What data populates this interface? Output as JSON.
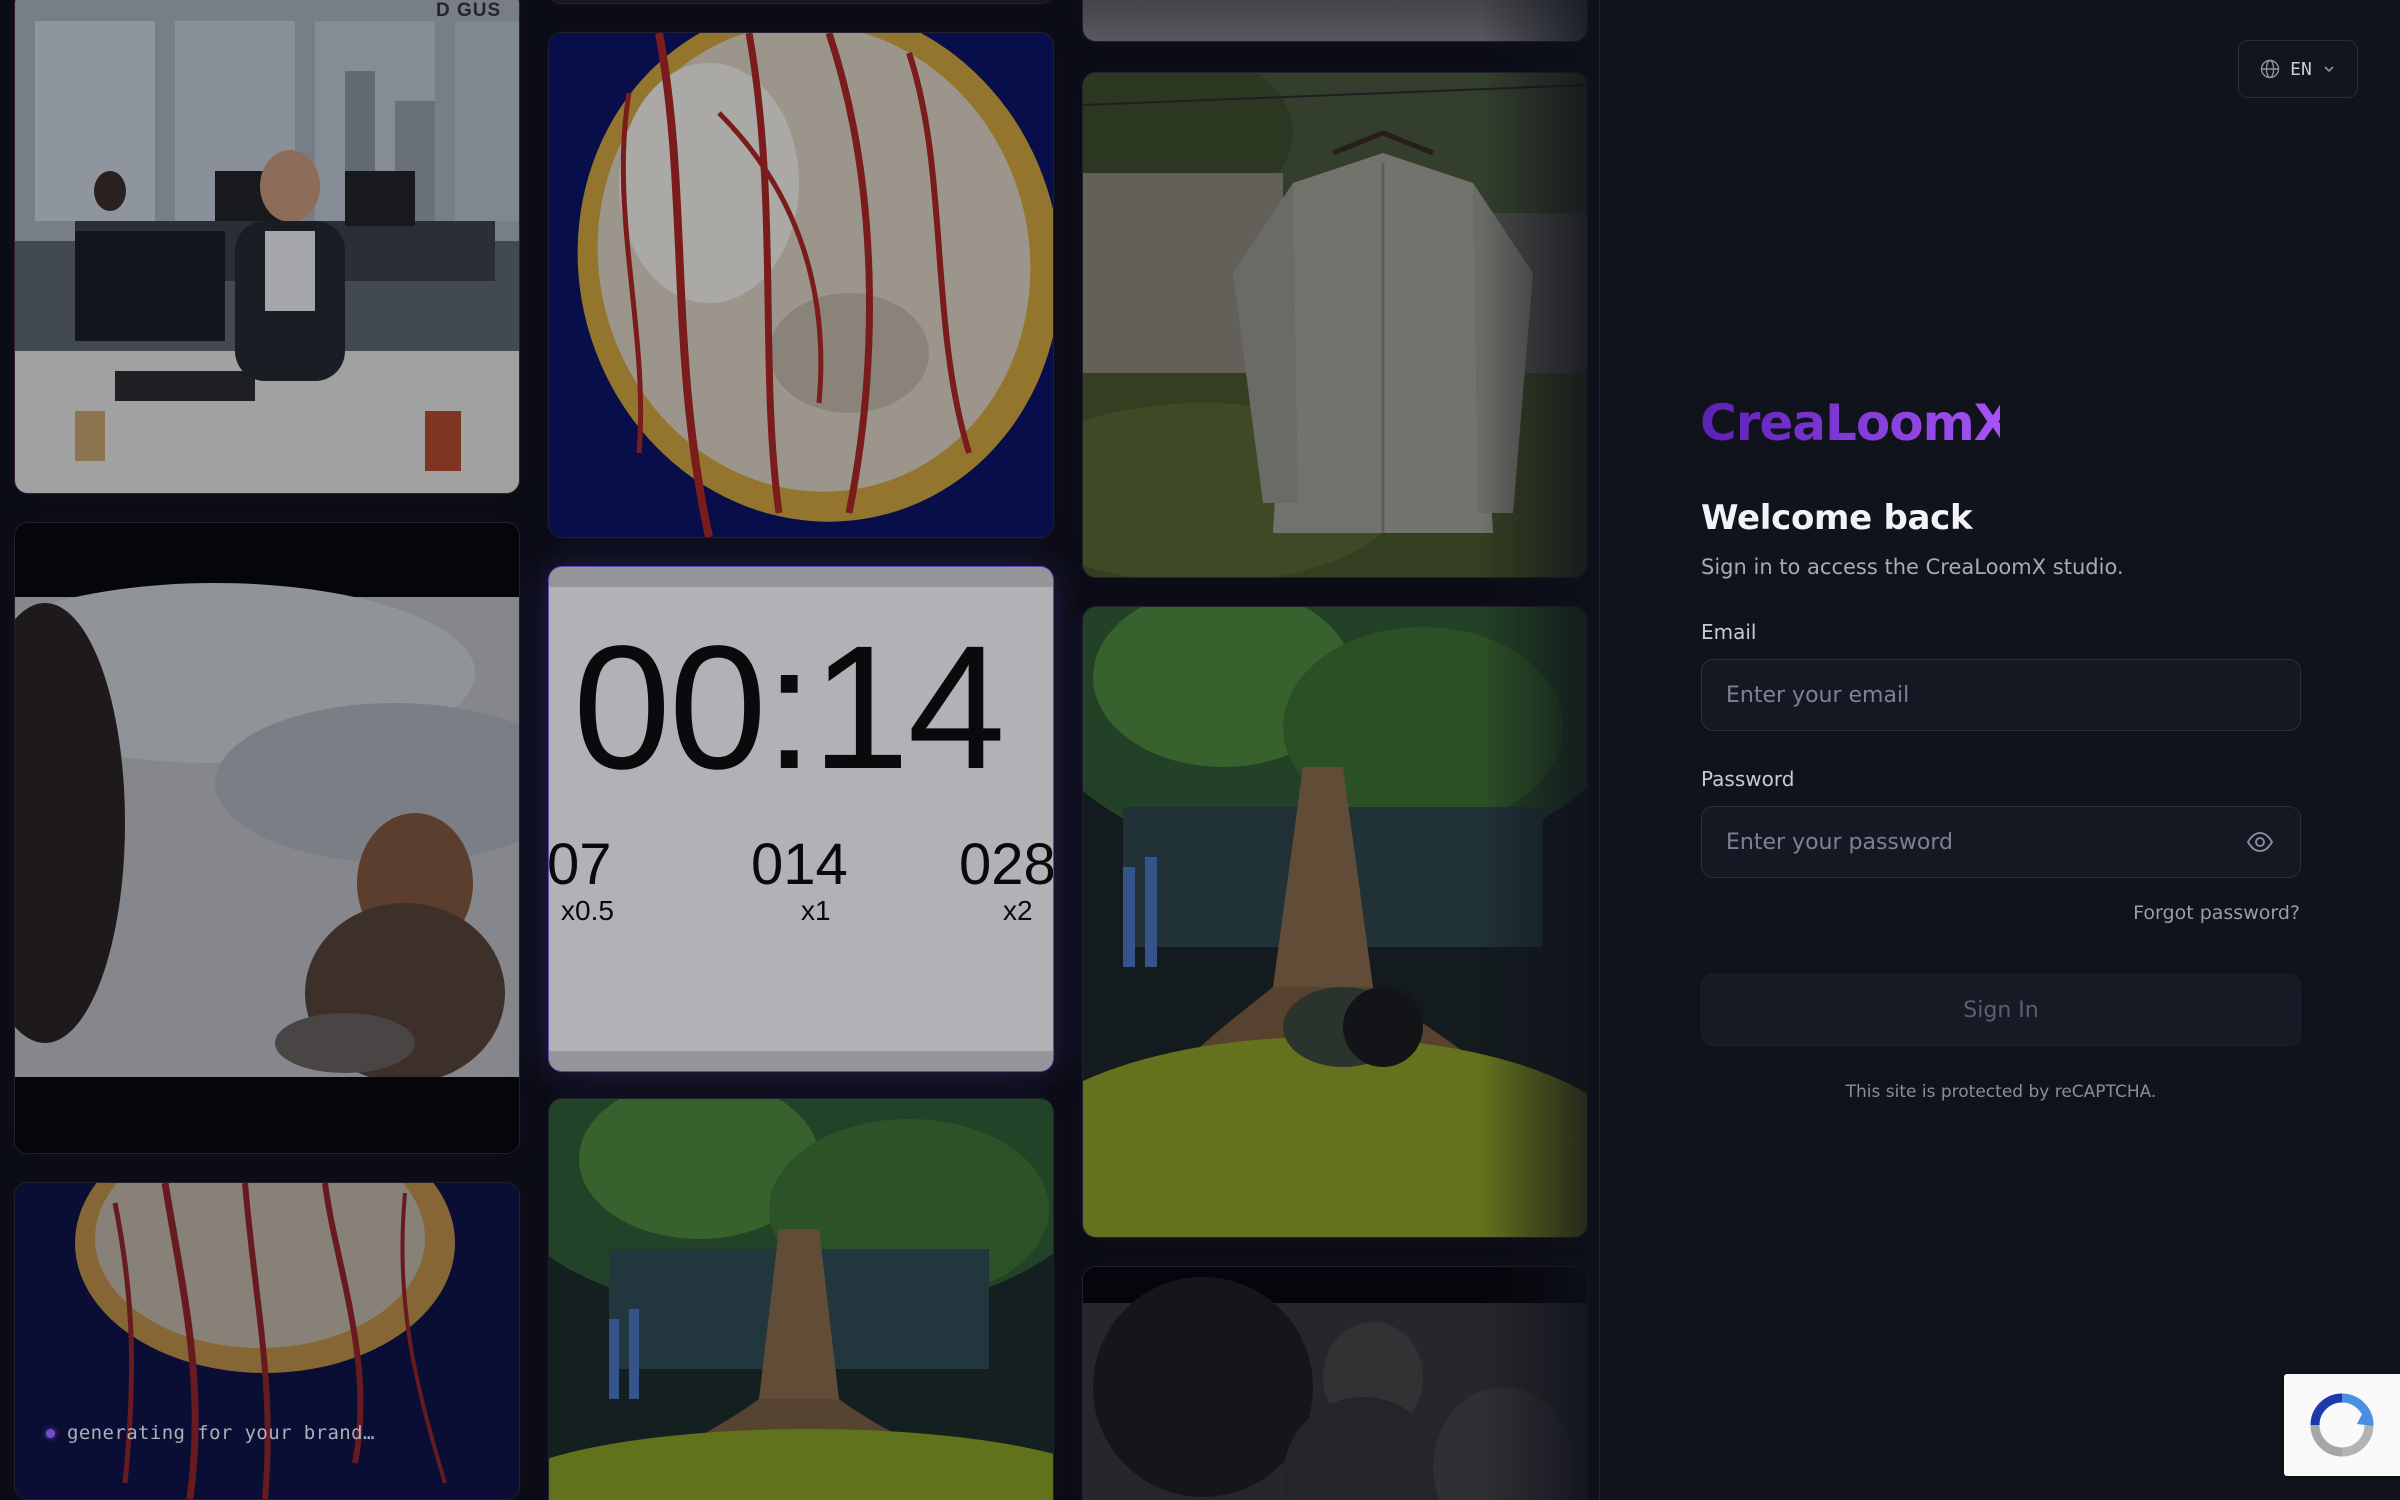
{
  "gallery": {
    "watermark": "D GUS",
    "timer": {
      "main": "00:14",
      "ticks": [
        "07",
        "014",
        "028"
      ],
      "speeds": [
        "x0.5",
        "x1",
        "x2"
      ]
    },
    "status_text": "generating for your brand…"
  },
  "header": {
    "language": "EN"
  },
  "brand": {
    "name": "CreaLoomX",
    "gradient_from": "#5b21b6",
    "gradient_to": "#a855f7"
  },
  "login": {
    "title": "Welcome back",
    "subtitle": "Sign in to access the CreaLoomX studio.",
    "email_label": "Email",
    "email_placeholder": "Enter your email",
    "password_label": "Password",
    "password_placeholder": "Enter your password",
    "forgot_password": "Forgot password?",
    "submit_label": "Sign In",
    "recaptcha_note": "This site is protected by reCAPTCHA."
  }
}
